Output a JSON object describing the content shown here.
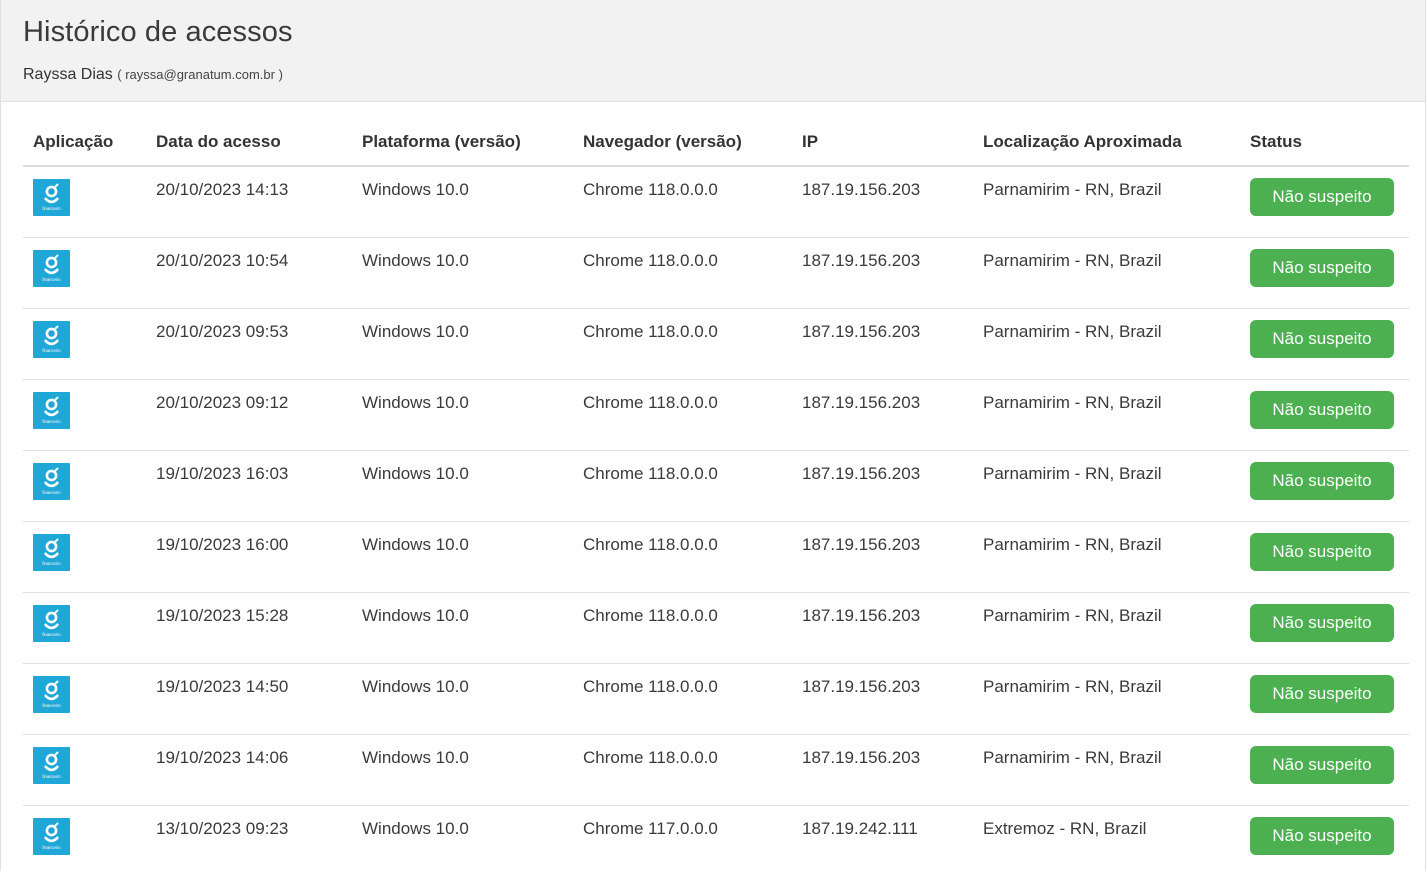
{
  "header": {
    "title": "Histórico de acessos",
    "user_name": "Rayssa Dias",
    "user_email": "( rayssa@granatum.com.br )"
  },
  "table": {
    "columns": [
      "Aplicação",
      "Data do acesso",
      "Plataforma (versão)",
      "Navegador (versão)",
      "IP",
      "Localização Aproximada",
      "Status"
    ],
    "rows": [
      {
        "icon": "granatum-financeiro-icon",
        "app_caption": "financeiro",
        "date": "20/10/2023 14:13",
        "platform": "Windows 10.0",
        "browser": "Chrome 118.0.0.0",
        "ip": "187.19.156.203",
        "location": "Parnamirim - RN, Brazil",
        "status": "Não suspeito"
      },
      {
        "icon": "granatum-financeiro-icon",
        "app_caption": "financeiro",
        "date": "20/10/2023 10:54",
        "platform": "Windows 10.0",
        "browser": "Chrome 118.0.0.0",
        "ip": "187.19.156.203",
        "location": "Parnamirim - RN, Brazil",
        "status": "Não suspeito"
      },
      {
        "icon": "granatum-financeiro-icon",
        "app_caption": "financeiro",
        "date": "20/10/2023 09:53",
        "platform": "Windows 10.0",
        "browser": "Chrome 118.0.0.0",
        "ip": "187.19.156.203",
        "location": "Parnamirim - RN, Brazil",
        "status": "Não suspeito"
      },
      {
        "icon": "granatum-financeiro-icon",
        "app_caption": "financeiro",
        "date": "20/10/2023 09:12",
        "platform": "Windows 10.0",
        "browser": "Chrome 118.0.0.0",
        "ip": "187.19.156.203",
        "location": "Parnamirim - RN, Brazil",
        "status": "Não suspeito"
      },
      {
        "icon": "granatum-financeiro-icon",
        "app_caption": "financeiro",
        "date": "19/10/2023 16:03",
        "platform": "Windows 10.0",
        "browser": "Chrome 118.0.0.0",
        "ip": "187.19.156.203",
        "location": "Parnamirim - RN, Brazil",
        "status": "Não suspeito"
      },
      {
        "icon": "granatum-financeiro-icon",
        "app_caption": "financeiro",
        "date": "19/10/2023 16:00",
        "platform": "Windows 10.0",
        "browser": "Chrome 118.0.0.0",
        "ip": "187.19.156.203",
        "location": "Parnamirim - RN, Brazil",
        "status": "Não suspeito"
      },
      {
        "icon": "granatum-financeiro-icon",
        "app_caption": "financeiro",
        "date": "19/10/2023 15:28",
        "platform": "Windows 10.0",
        "browser": "Chrome 118.0.0.0",
        "ip": "187.19.156.203",
        "location": "Parnamirim - RN, Brazil",
        "status": "Não suspeito"
      },
      {
        "icon": "granatum-financeiro-icon",
        "app_caption": "financeiro",
        "date": "19/10/2023 14:50",
        "platform": "Windows 10.0",
        "browser": "Chrome 118.0.0.0",
        "ip": "187.19.156.203",
        "location": "Parnamirim - RN, Brazil",
        "status": "Não suspeito"
      },
      {
        "icon": "granatum-financeiro-icon",
        "app_caption": "financeiro",
        "date": "19/10/2023 14:06",
        "platform": "Windows 10.0",
        "browser": "Chrome 118.0.0.0",
        "ip": "187.19.156.203",
        "location": "Parnamirim - RN, Brazil",
        "status": "Não suspeito"
      },
      {
        "icon": "granatum-financeiro-icon",
        "app_caption": "financeiro",
        "date": "13/10/2023 09:23",
        "platform": "Windows 10.0",
        "browser": "Chrome 117.0.0.0",
        "ip": "187.19.242.111",
        "location": "Extremoz - RN, Brazil",
        "status": "Não suspeito"
      }
    ]
  },
  "colors": {
    "header_bg": "#f2f2f2",
    "app_icon_bg": "#1ea7d7",
    "status_ok": "#4cb050"
  }
}
